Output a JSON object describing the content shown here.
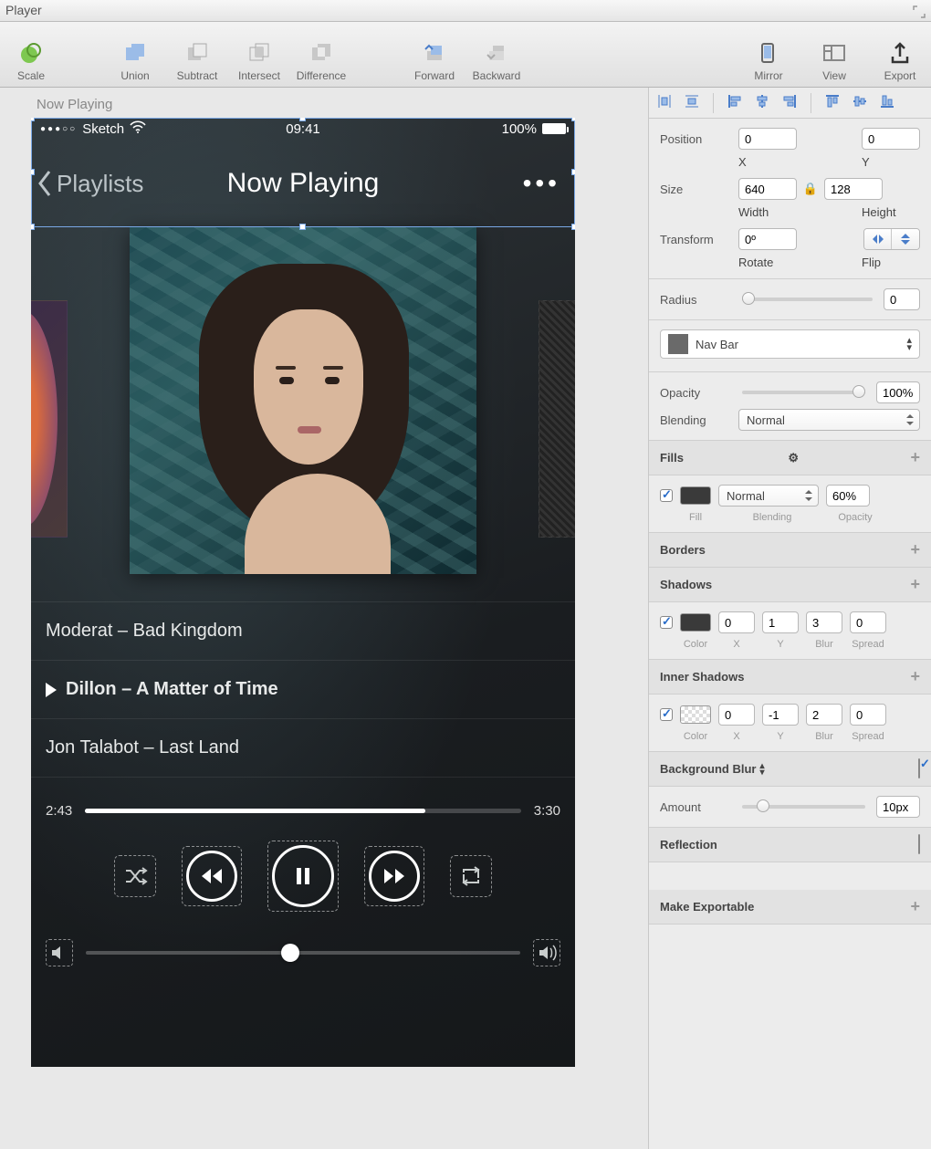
{
  "window": {
    "title": "Player"
  },
  "toolbar": {
    "scale": "Scale",
    "union": "Union",
    "subtract": "Subtract",
    "intersect": "Intersect",
    "difference": "Difference",
    "forward": "Forward",
    "backward": "Backward",
    "mirror": "Mirror",
    "view": "View",
    "export": "Export"
  },
  "canvas": {
    "artboard_label": "Now Playing",
    "statusbar": {
      "carrier": "Sketch",
      "time": "09:41",
      "battery": "100%"
    },
    "nav": {
      "back": "Playlists",
      "title": "Now Playing"
    },
    "tracks": [
      {
        "text": "Moderat – Bad Kingdom",
        "playing": false
      },
      {
        "text": "Dillon – A Matter of Time",
        "playing": true
      },
      {
        "text": "Jon Talabot – Last Land",
        "playing": false
      }
    ],
    "progress": {
      "elapsed": "2:43",
      "total": "3:30"
    }
  },
  "inspector": {
    "position": {
      "label": "Position",
      "x": "0",
      "y": "0",
      "xlabel": "X",
      "ylabel": "Y"
    },
    "size": {
      "label": "Size",
      "w": "640",
      "h": "128",
      "wlabel": "Width",
      "hlabel": "Height"
    },
    "transform": {
      "label": "Transform",
      "rotate": "0º",
      "rotlabel": "Rotate",
      "fliplabel": "Flip"
    },
    "radius": {
      "label": "Radius",
      "value": "0"
    },
    "layer_name": "Nav Bar",
    "opacity": {
      "label": "Opacity",
      "value": "100%"
    },
    "blending": {
      "label": "Blending",
      "value": "Normal"
    },
    "fills": {
      "header": "Fills",
      "fill_label": "Fill",
      "blending_label": "Blending",
      "blending_value": "Normal",
      "opacity_label": "Opacity",
      "opacity_value": "60%"
    },
    "borders": {
      "header": "Borders"
    },
    "shadows": {
      "header": "Shadows",
      "color_label": "Color",
      "x_label": "X",
      "y_label": "Y",
      "blur_label": "Blur",
      "spread_label": "Spread",
      "x": "0",
      "y": "1",
      "blur": "3",
      "spread": "0"
    },
    "inner_shadows": {
      "header": "Inner Shadows",
      "x": "0",
      "y": "-1",
      "blur": "2",
      "spread": "0"
    },
    "bgblur": {
      "header": "Background Blur",
      "amount_label": "Amount",
      "amount": "10px"
    },
    "reflection": {
      "header": "Reflection"
    },
    "exportable": {
      "header": "Make Exportable"
    }
  }
}
